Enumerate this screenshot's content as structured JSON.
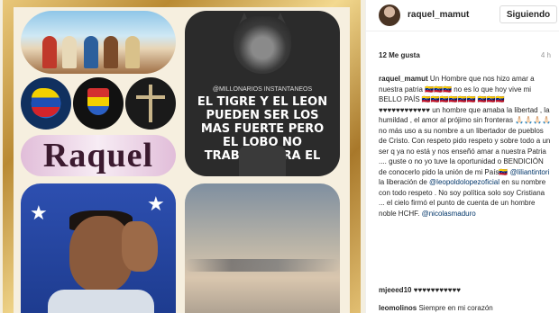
{
  "post": {
    "username": "raquel_mamut",
    "follow_label": "Siguiendo",
    "likes": "12 Me gusta",
    "time_ago": "4 h",
    "image": {
      "name_tile": "Raquel",
      "wolf_small_text": "@MILLONARIOS INSTANTANEOS",
      "wolf_text": "EL TIGRE Y EL LEON PUEDEN SER LOS MAS FUERTE PERO EL LOBO NO TRABAJA PARA EL CIRCO"
    },
    "caption": {
      "part1": "Un Hombre que nos hizo amar a nuestra patria 🇻🇪🇻🇪🇻🇪 no es lo que hoy vive mi BELLO PAÍS 🇻🇪🇻🇪🇻🇪🇻🇪🇻🇪🇻🇪 🇻🇪🇻🇪🇻🇪 ♥♥♥♥♥♥♥♥♥♥♥♥ un hombre que amaba la libertad , la humildad , el amor al prójimo sin fronteras 🙏🏻🙏🏻🙏🏻🙏🏻 no más uso a su nombre a un libertador de pueblos de Cristo. Con respeto pido respeto y sobre todo a un ser q ya no está y nos enseñó amar a nuestra Patria .... guste o no yo tuve la oportunidad o BENDICIÓN de conocerlo pido la unión de mi País🇻🇪",
      "mention1": "@liliantintori",
      "part2": " la liberación de ",
      "mention2": "@leopoldolopezoficial",
      "part3": " en su nombre con todo respeto . No soy política solo soy Cristiana ... el cielo firmó el punto de cuenta de un hombre noble HCHF.",
      "mention3": "@nicolasmaduro"
    },
    "comments": [
      {
        "user": "mjeeed10",
        "text": "♥♥♥♥♥♥♥♥♥♥♥"
      },
      {
        "user": "leomolinos",
        "text": "Siempre en mi corazón"
      }
    ]
  }
}
